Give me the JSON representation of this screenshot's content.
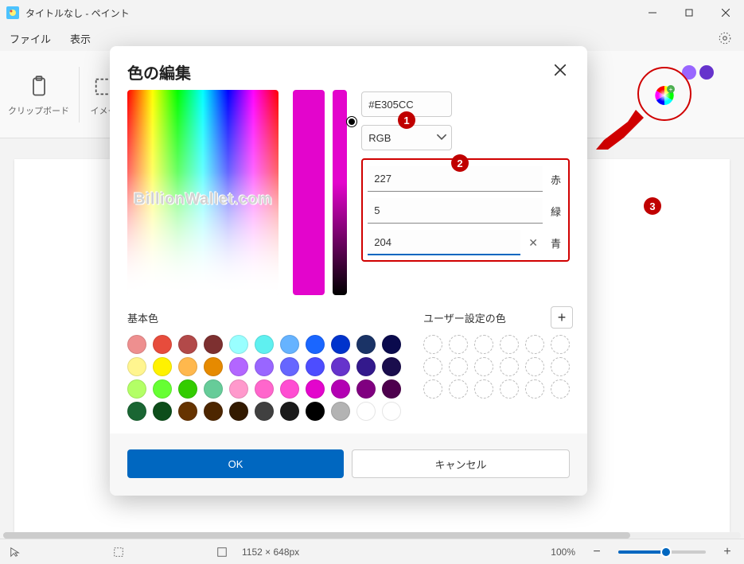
{
  "window": {
    "title": "タイトルなし - ペイント"
  },
  "menubar": {
    "file": "ファイル",
    "view": "表示"
  },
  "ribbon": {
    "clipboard_label": "クリップボード",
    "image_label": "イメー"
  },
  "dialog": {
    "title": "色の編集",
    "hex_value": "#E305CC",
    "color_model": "RGB",
    "red_value": "227",
    "green_value": "5",
    "blue_value": "204",
    "red_label": "赤",
    "green_label": "緑",
    "blue_label": "青",
    "basic_colors_label": "基本色",
    "user_colors_label": "ユーザー設定の色",
    "ok_label": "OK",
    "cancel_label": "キャンセル",
    "basic_colors": [
      "#ee8f8f",
      "#e74c3c",
      "#b24949",
      "#7d3030",
      "#99ffff",
      "#5ff0f0",
      "#66b3ff",
      "#1a66ff",
      "#0033cc",
      "#1a3366",
      "#0a0a4d",
      "#fff58f",
      "#fff200",
      "#ffb84d",
      "#e68a00",
      "#b366ff",
      "#9966ff",
      "#6666ff",
      "#4d4dff",
      "#6633cc",
      "#33198c",
      "#1a0d4d",
      "#b3ff66",
      "#66ff33",
      "#33cc00",
      "#66cc99",
      "#ff99cc",
      "#ff66cc",
      "#ff4dd2",
      "#e305cc",
      "#b300b3",
      "#800080",
      "#4d004d",
      "#1a6633",
      "#0d4d1a",
      "#663300",
      "#4d2600",
      "#331a00",
      "#404040",
      "#1a1a1a",
      "#000000",
      "#b3b3b3",
      "#ffffff",
      "#ffffff"
    ],
    "user_colors_count": 18
  },
  "statusbar": {
    "canvas_size": "1152 × 648px",
    "zoom_text": "100%"
  },
  "callouts": {
    "one": "1",
    "two": "2",
    "three": "3"
  },
  "watermark": "BillionWallet.com",
  "palette_swatches": [
    "#9966ff",
    "#6633cc"
  ]
}
